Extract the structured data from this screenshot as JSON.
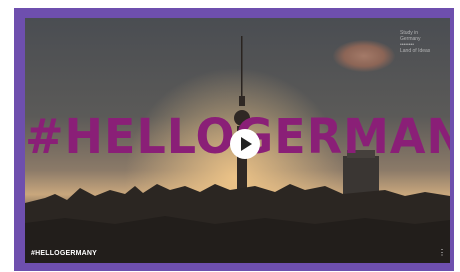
{
  "video": {
    "headline": "#HELLOGERMANY",
    "caption": "#HELLOGERMANY",
    "watermark_lines": [
      "Study in",
      "Germany",
      "••••••••",
      "Land of Ideas"
    ],
    "play_icon": "play-icon",
    "menu_icon": "more-icon"
  },
  "colors": {
    "frame": "#6e4fae",
    "headline": "#8a1f77"
  }
}
